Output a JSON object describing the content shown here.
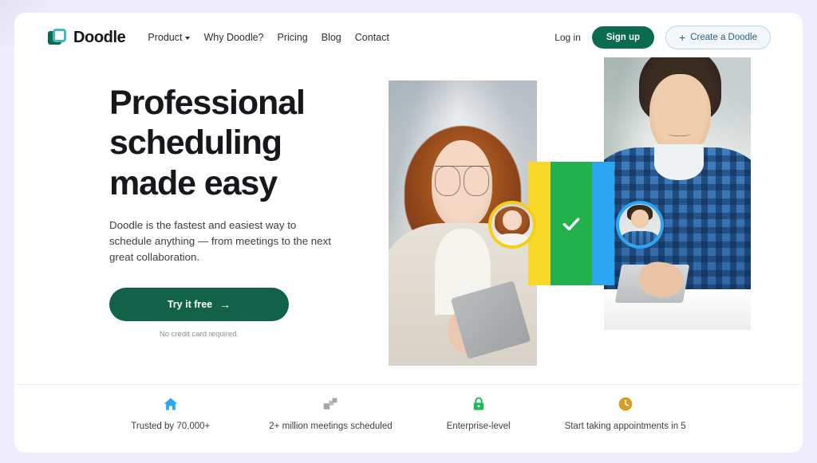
{
  "header": {
    "brand": {
      "name": "Doodle",
      "logo_icon": "doodle-logo-icon"
    },
    "nav": [
      {
        "label": "Product",
        "has_caret": true
      },
      {
        "label": "Why Doodle?",
        "has_caret": false
      },
      {
        "label": "Pricing",
        "has_caret": false
      },
      {
        "label": "Blog",
        "has_caret": false
      },
      {
        "label": "Contact",
        "has_caret": false
      }
    ],
    "actions": {
      "login_label": "Log in",
      "signup_label": "Sign up",
      "create_label": "Create a Doodle",
      "create_icon": "plus-icon"
    }
  },
  "hero": {
    "title_line1": "Professional",
    "title_line2": "scheduling",
    "title_line3": "made easy",
    "subtitle": "Doodle is the fastest and easiest way to schedule anything — from meetings to the next great collaboration.",
    "cta_label": "Try it free",
    "cta_arrow": "→",
    "cta_note": "No credit card required."
  },
  "collage": {
    "photo_left_alt": "Woman with glasses holding a tablet in an office",
    "photo_right_alt": "Man in plaid shirt working at a desk with a laptop",
    "avatar_left_alt": "Avatar of woman with yellow ring",
    "avatar_right_alt": "Avatar of man with blue ring",
    "card_check_icon": "checkmark-icon",
    "stripe_colors": [
      "#f8d828",
      "#22b14c",
      "#2ba6f0"
    ]
  },
  "trust_bar": {
    "items": [
      {
        "icon": "house-icon",
        "icon_color": "#2ba6f0",
        "label": "Trusted by 70,000+"
      },
      {
        "icon": "squares-icon",
        "icon_color": "#a6a6a6",
        "label": "2+ million meetings scheduled"
      },
      {
        "icon": "lock-icon",
        "icon_color": "#1db954",
        "label": "Enterprise-level"
      },
      {
        "icon": "clock-icon",
        "icon_color": "#d99c25",
        "label": "Start taking appointments in 5"
      }
    ]
  },
  "theme": {
    "brand_green": "#0b6b4f",
    "cta_green": "#12624a",
    "accent_blue": "#2ba6f0",
    "page_bg": "#efecfb",
    "card_bg": "#ffffff"
  }
}
